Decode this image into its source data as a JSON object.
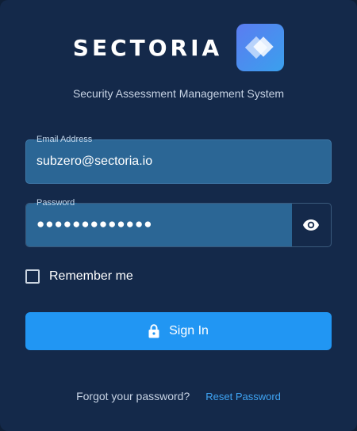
{
  "brand": {
    "name": "SECTORIA",
    "logo_icon": "diamond-logo-icon"
  },
  "subtitle": "Security Assessment Management System",
  "email": {
    "label": "Email Address",
    "value": "subzero@sectoria.io"
  },
  "password": {
    "label": "Password",
    "masked_value": "●●●●●●●●●●●●●",
    "toggle_icon": "eye-icon"
  },
  "remember": {
    "label": "Remember me",
    "checked": false
  },
  "signin": {
    "label": "Sign In",
    "icon": "lock-icon"
  },
  "footer": {
    "forgot_text": "Forgot your password?",
    "reset_link": "Reset Password"
  },
  "colors": {
    "background": "#14294a",
    "field": "#2b6695",
    "primary": "#2196f3",
    "link": "#3fa5f5"
  }
}
